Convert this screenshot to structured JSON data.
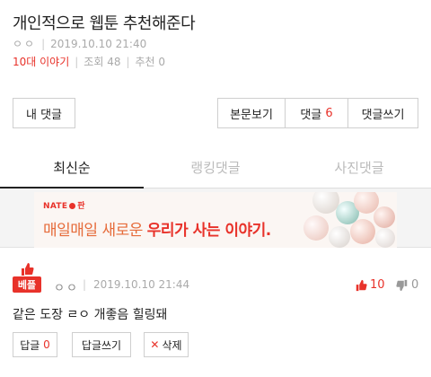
{
  "post": {
    "title": "개인적으로 웹툰 추천해준다",
    "author": "ㅇㅇ",
    "date": "2019.10.10 21:40",
    "board": "10대 이야기",
    "views_label": "조회 48",
    "recommend_label": "추천 0"
  },
  "buttons": {
    "my_comments": "내 댓글",
    "view_body": "본문보기",
    "comments_label": "댓글",
    "comments_count": "6",
    "write_comment": "댓글쓰기"
  },
  "tabs": [
    {
      "label": "최신순",
      "active": true
    },
    {
      "label": "랭킹댓글",
      "active": false
    },
    {
      "label": "사진댓글",
      "active": false
    }
  ],
  "ad": {
    "brand": "NATE",
    "brand_suffix": "판",
    "headline_plain": "매일매일 새로운 ",
    "headline_bold": "우리가 사는 이야기."
  },
  "comment": {
    "badge": "베플",
    "author": "ㅇㅇ",
    "date": "2019.10.10 21:44",
    "likes": "10",
    "dislikes": "0",
    "text": "같은 도장 ㄹㅇ 개좋음 힐링돼",
    "reply_label": "답글",
    "reply_count": "0",
    "write_reply": "답글쓰기",
    "delete": "삭제"
  },
  "colors": {
    "accent": "#e8322a",
    "muted": "#aaaaaa",
    "border": "#cfcfcf"
  }
}
